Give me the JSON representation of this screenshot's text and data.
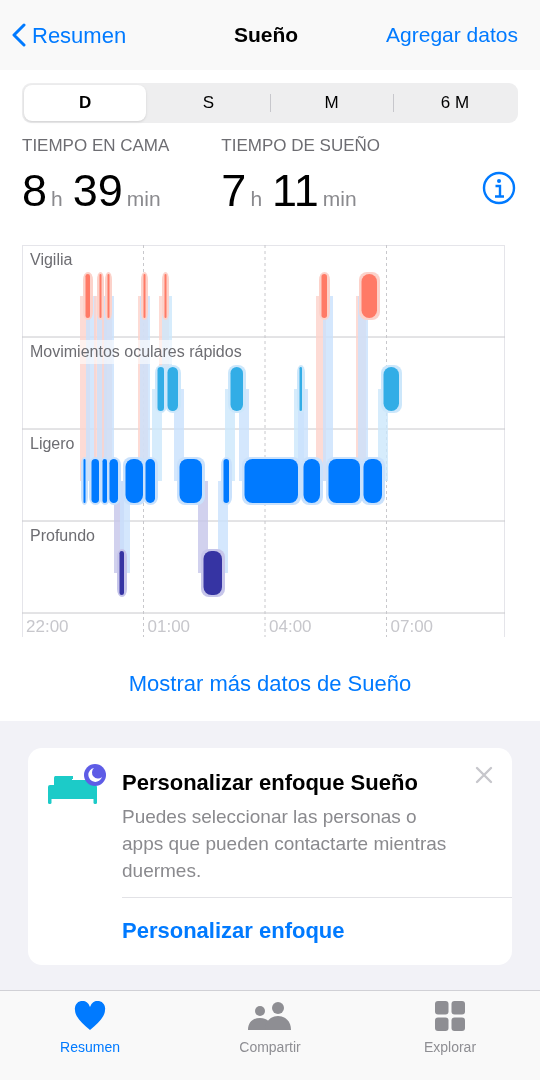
{
  "nav": {
    "back": "Resumen",
    "title": "Sueño",
    "action": "Agregar datos"
  },
  "segments": [
    {
      "label": "D",
      "selected": true
    },
    {
      "label": "S",
      "selected": false
    },
    {
      "label": "M",
      "selected": false
    },
    {
      "label": "6 M",
      "selected": false
    }
  ],
  "stats": [
    {
      "label": "TIEMPO EN CAMA",
      "hours": "8",
      "hours_unit": "h",
      "minutes": "39",
      "minutes_unit": "min"
    },
    {
      "label": "TIEMPO DE SUEÑO",
      "hours": "7",
      "hours_unit": "h",
      "minutes": "11",
      "minutes_unit": "min"
    }
  ],
  "chart": {
    "stages": [
      "Vigilia",
      "Movimientos oculares rápidos",
      "Ligero",
      "Profundo"
    ],
    "time_labels": [
      "22:00",
      "01:00",
      "04:00",
      "07:00"
    ]
  },
  "more_link": "Mostrar más datos de Sueño",
  "card": {
    "title": "Personalizar enfoque Sueño",
    "body": "Puedes seleccionar las personas o apps que pueden contactarte mientras duermes.",
    "action": "Personalizar enfoque"
  },
  "tabs": [
    {
      "label": "Resumen",
      "kind": "heart",
      "selected": true
    },
    {
      "label": "Compartir",
      "kind": "people",
      "selected": false
    },
    {
      "label": "Explorar",
      "kind": "grid",
      "selected": false
    }
  ]
}
